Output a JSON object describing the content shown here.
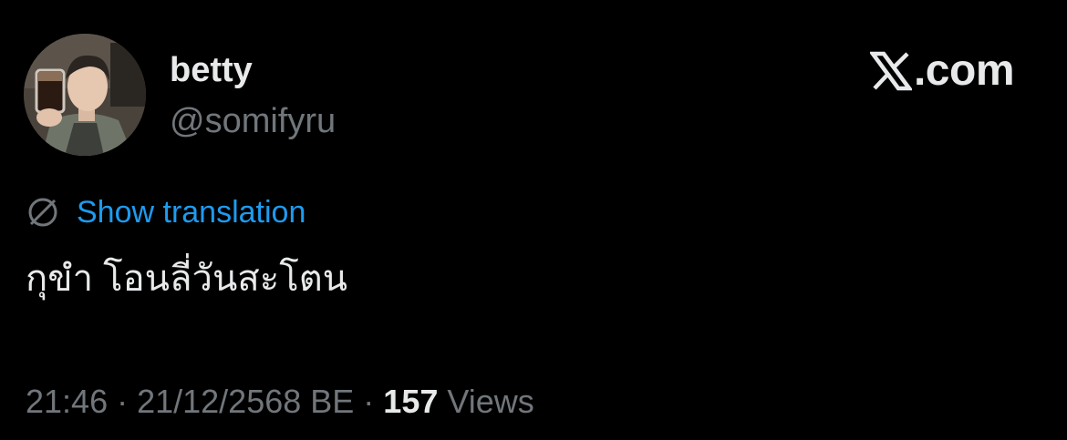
{
  "author": {
    "display_name": "betty",
    "handle": "@somifyru",
    "avatar_icon": "profile-photo"
  },
  "brand": {
    "logo_icon": "x-logo-icon",
    "text": ".com"
  },
  "translation": {
    "icon": "globe-icon",
    "label": "Show translation"
  },
  "tweet": {
    "text": "กุขำ โอนลี่วันสะโตน"
  },
  "meta": {
    "time": "21:46",
    "separator_1": " · ",
    "date": "21/12/2568 BE",
    "separator_2": " · ",
    "views_count": "157",
    "views_label": " Views"
  },
  "colors": {
    "background": "#000000",
    "primary_text": "#e7e9ea",
    "secondary_text": "#71767b",
    "link": "#1d9bf0"
  }
}
